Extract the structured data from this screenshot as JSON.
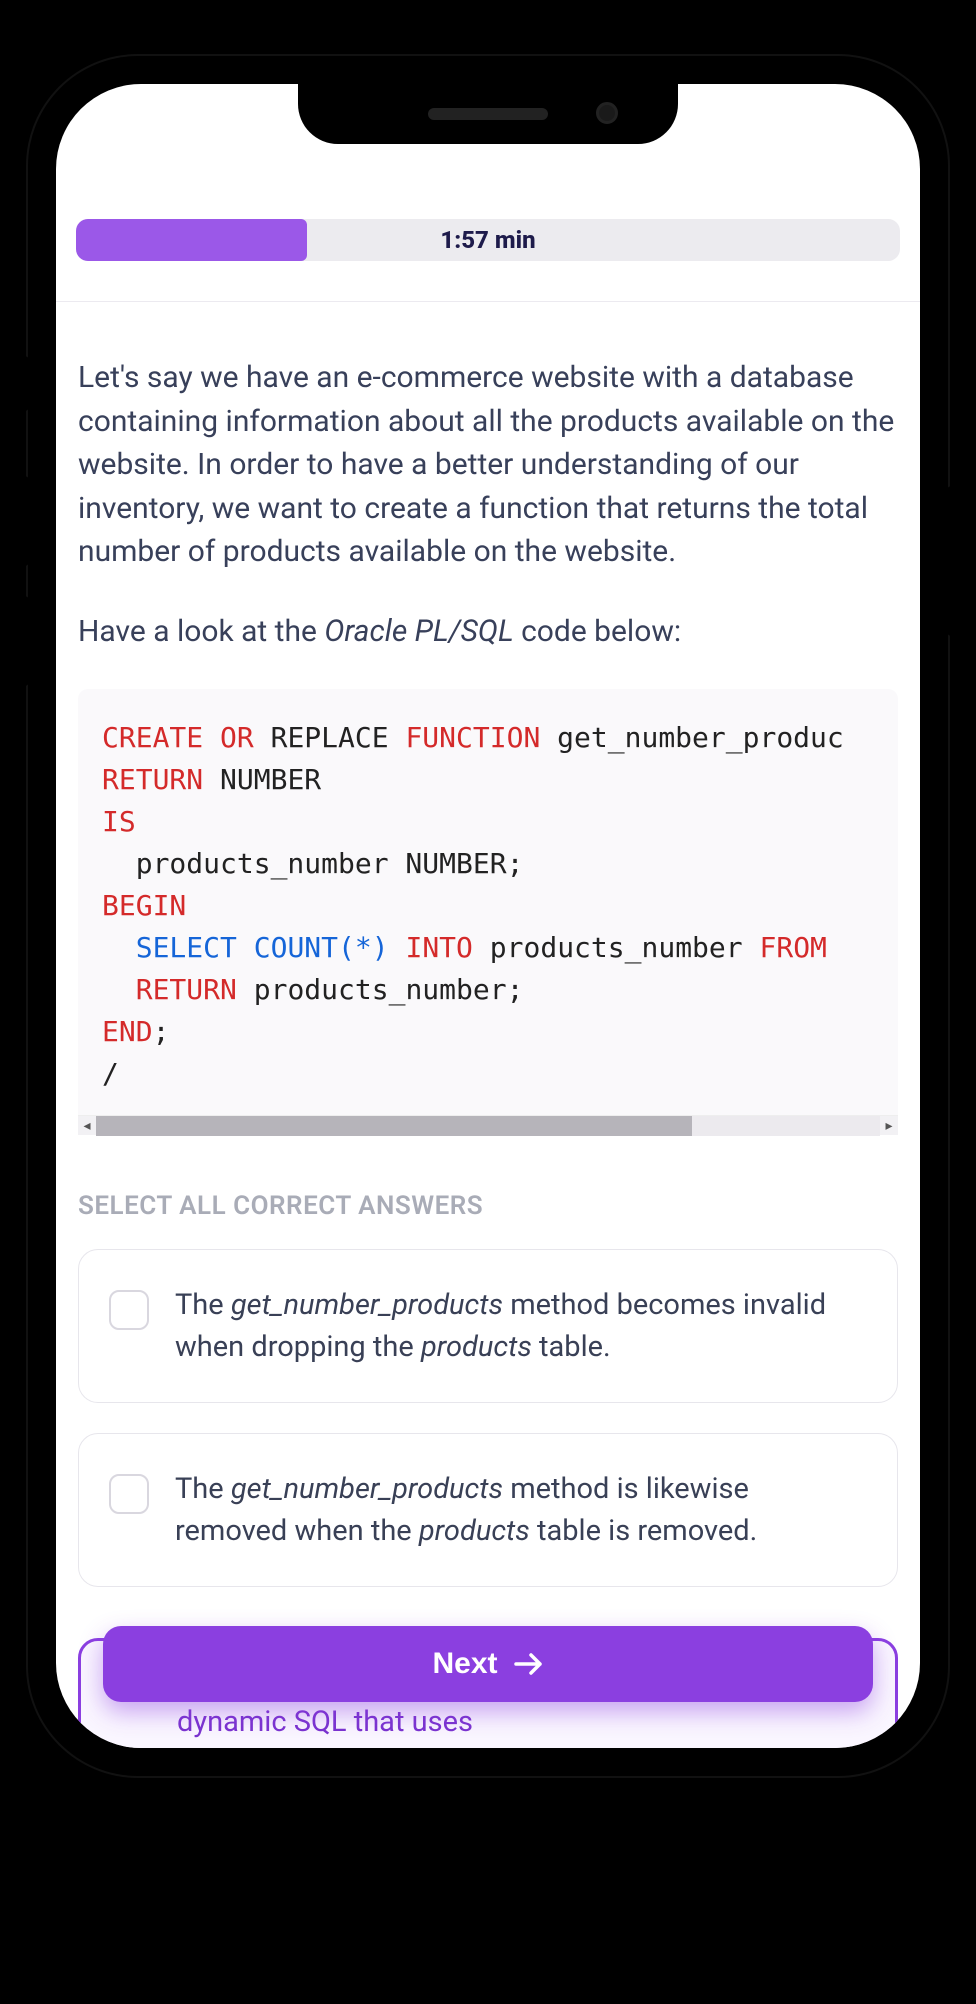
{
  "progress": {
    "percent": 28,
    "timer": "1:57 min"
  },
  "question": {
    "para1": "Let's say we have an e-commerce website with a database containing information about all the products available on the website. In order to have a better understanding of our inventory, we want to create a function that returns the total number of products available on the website.",
    "para2_prefix": "Have a look at the ",
    "para2_em": "Oracle PL/SQL",
    "para2_suffix": " code below:"
  },
  "code": {
    "l1_a": "CREATE",
    "l1_b": " OR ",
    "l1_c": "REPLACE ",
    "l1_d": "FUNCTION",
    "l1_e": " get_number_produc",
    "l2_a": "RETURN",
    "l2_b": " NUMBER",
    "l3_a": "IS",
    "l4": "  products_number NUMBER;",
    "l5_a": "BEGIN",
    "l6_a": "  ",
    "l6_b": "SELECT",
    "l6_c": " ",
    "l6_d": "COUNT",
    "l6_e": "(",
    "l6_f": "*",
    "l6_g": ")",
    "l6_h": " ",
    "l6_i": "INTO",
    "l6_j": " products_number ",
    "l6_k": "FROM",
    "l7_a": "  ",
    "l7_b": "RETURN",
    "l7_c": " products_number;",
    "l8_a": "END",
    "l8_b": ";",
    "l9": "/"
  },
  "answers_label": "SELECT ALL CORRECT ANSWERS",
  "answers": {
    "a1_pre": "The ",
    "a1_em1": "get_number_products",
    "a1_mid": " method becomes invalid when dropping the ",
    "a1_em2": "products",
    "a1_post": " table.",
    "a2_pre": "The ",
    "a2_em1": "get_number_products",
    "a2_mid": " method is likewise removed when the ",
    "a2_em2": "products",
    "a2_post": " table is removed.",
    "a3_frag": "dynamic SQL that uses"
  },
  "next_label": "Next",
  "colors": {
    "accent": "#8b3fe0",
    "progress_fill": "#9b58e8"
  }
}
